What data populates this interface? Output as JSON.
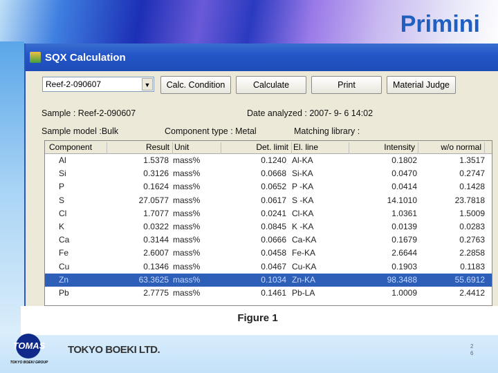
{
  "slide": {
    "title": "Primini",
    "caption": "Figure 1",
    "company": "TOKYO BOEKI LTD.",
    "page": "26",
    "logo": {
      "text": "TOMAS",
      "group": "TOKYO BOEKI GROUP"
    }
  },
  "window": {
    "title": "SQX Calculation",
    "sample_select": "Reef-2-090607",
    "buttons": [
      "Calc. Condition",
      "Calculate",
      "Print",
      "Material Judge"
    ],
    "sample": "Sample :  Reef-2-090607",
    "date": "Date analyzed : 2007- 9- 6 14:02",
    "model": "Sample model :Bulk",
    "component_type": "Component type :  Metal",
    "matching": "Matching library :"
  },
  "table": {
    "headers": [
      "Component",
      "Result",
      "Unit",
      "Det. limit",
      "El. line",
      "Intensity",
      "w/o normal"
    ],
    "selected_row": 9,
    "rows": [
      [
        "Al",
        "1.5378",
        "mass%",
        "0.1240",
        "Al-KA",
        "0.1802",
        "1.3517"
      ],
      [
        "Si",
        "0.3126",
        "mass%",
        "0.0668",
        "Si-KA",
        "0.0470",
        "0.2747"
      ],
      [
        "P",
        "0.1624",
        "mass%",
        "0.0652",
        "P -KA",
        "0.0414",
        "0.1428"
      ],
      [
        "S",
        "27.0577",
        "mass%",
        "0.0617",
        "S -KA",
        "14.1010",
        "23.7818"
      ],
      [
        "Cl",
        "1.7077",
        "mass%",
        "0.0241",
        "Cl-KA",
        "1.0361",
        "1.5009"
      ],
      [
        "K",
        "0.0322",
        "mass%",
        "0.0845",
        "K -KA",
        "0.0139",
        "0.0283"
      ],
      [
        "Ca",
        "0.3144",
        "mass%",
        "0.0666",
        "Ca-KA",
        "0.1679",
        "0.2763"
      ],
      [
        "Fe",
        "2.6007",
        "mass%",
        "0.0458",
        "Fe-KA",
        "2.6644",
        "2.2858"
      ],
      [
        "Cu",
        "0.1346",
        "mass%",
        "0.0467",
        "Cu-KA",
        "0.1903",
        "0.1183"
      ],
      [
        "Zn",
        "63.3625",
        "mass%",
        "0.1034",
        "Zn-KA",
        "98.3488",
        "55.6912"
      ],
      [
        "Pb",
        "2.7775",
        "mass%",
        "0.1461",
        "Pb-LA",
        "1.0009",
        "2.4412"
      ]
    ]
  }
}
